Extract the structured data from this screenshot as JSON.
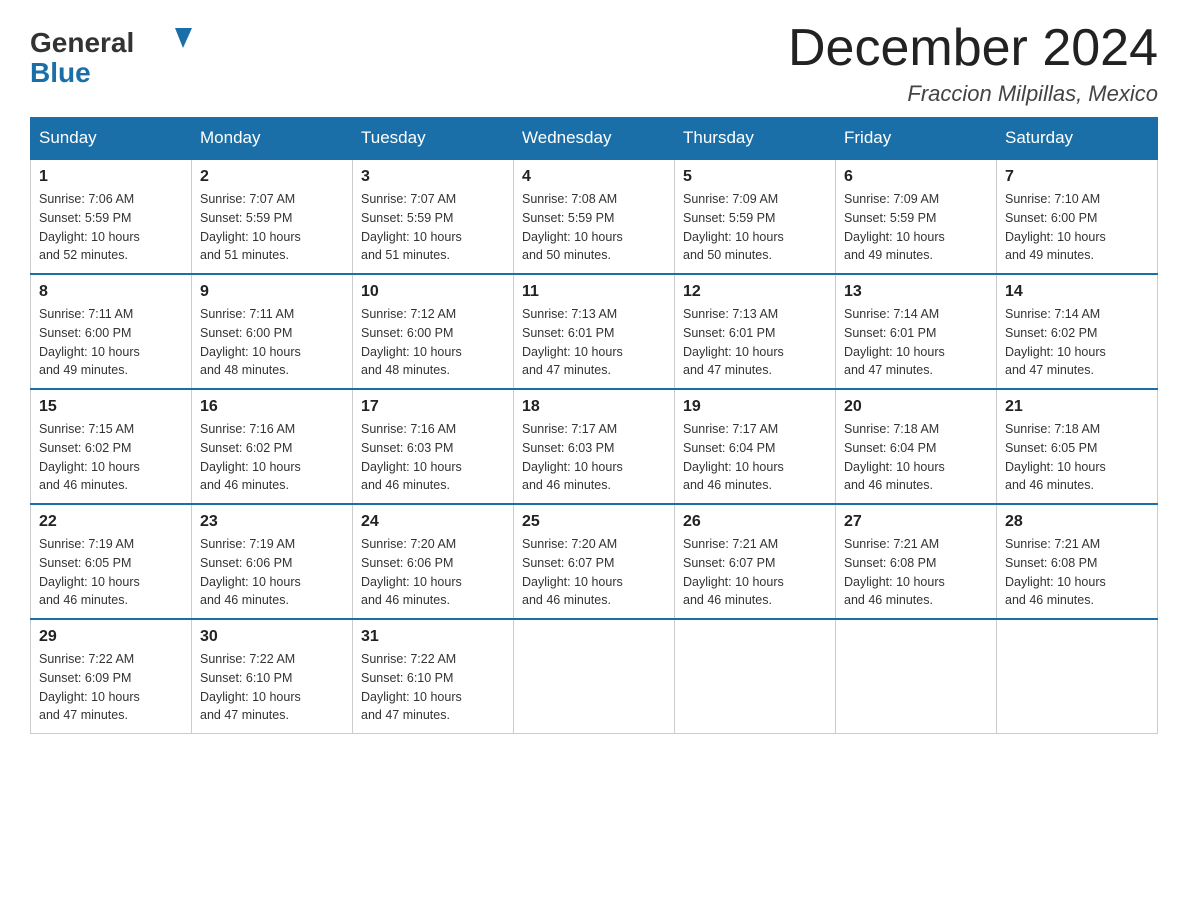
{
  "header": {
    "logo_general": "General",
    "logo_blue": "Blue",
    "month_title": "December 2024",
    "location": "Fraccion Milpillas, Mexico"
  },
  "weekdays": [
    "Sunday",
    "Monday",
    "Tuesday",
    "Wednesday",
    "Thursday",
    "Friday",
    "Saturday"
  ],
  "weeks": [
    [
      {
        "day": "1",
        "sunrise": "7:06 AM",
        "sunset": "5:59 PM",
        "daylight": "10 hours and 52 minutes."
      },
      {
        "day": "2",
        "sunrise": "7:07 AM",
        "sunset": "5:59 PM",
        "daylight": "10 hours and 51 minutes."
      },
      {
        "day": "3",
        "sunrise": "7:07 AM",
        "sunset": "5:59 PM",
        "daylight": "10 hours and 51 minutes."
      },
      {
        "day": "4",
        "sunrise": "7:08 AM",
        "sunset": "5:59 PM",
        "daylight": "10 hours and 50 minutes."
      },
      {
        "day": "5",
        "sunrise": "7:09 AM",
        "sunset": "5:59 PM",
        "daylight": "10 hours and 50 minutes."
      },
      {
        "day": "6",
        "sunrise": "7:09 AM",
        "sunset": "5:59 PM",
        "daylight": "10 hours and 49 minutes."
      },
      {
        "day": "7",
        "sunrise": "7:10 AM",
        "sunset": "6:00 PM",
        "daylight": "10 hours and 49 minutes."
      }
    ],
    [
      {
        "day": "8",
        "sunrise": "7:11 AM",
        "sunset": "6:00 PM",
        "daylight": "10 hours and 49 minutes."
      },
      {
        "day": "9",
        "sunrise": "7:11 AM",
        "sunset": "6:00 PM",
        "daylight": "10 hours and 48 minutes."
      },
      {
        "day": "10",
        "sunrise": "7:12 AM",
        "sunset": "6:00 PM",
        "daylight": "10 hours and 48 minutes."
      },
      {
        "day": "11",
        "sunrise": "7:13 AM",
        "sunset": "6:01 PM",
        "daylight": "10 hours and 47 minutes."
      },
      {
        "day": "12",
        "sunrise": "7:13 AM",
        "sunset": "6:01 PM",
        "daylight": "10 hours and 47 minutes."
      },
      {
        "day": "13",
        "sunrise": "7:14 AM",
        "sunset": "6:01 PM",
        "daylight": "10 hours and 47 minutes."
      },
      {
        "day": "14",
        "sunrise": "7:14 AM",
        "sunset": "6:02 PM",
        "daylight": "10 hours and 47 minutes."
      }
    ],
    [
      {
        "day": "15",
        "sunrise": "7:15 AM",
        "sunset": "6:02 PM",
        "daylight": "10 hours and 46 minutes."
      },
      {
        "day": "16",
        "sunrise": "7:16 AM",
        "sunset": "6:02 PM",
        "daylight": "10 hours and 46 minutes."
      },
      {
        "day": "17",
        "sunrise": "7:16 AM",
        "sunset": "6:03 PM",
        "daylight": "10 hours and 46 minutes."
      },
      {
        "day": "18",
        "sunrise": "7:17 AM",
        "sunset": "6:03 PM",
        "daylight": "10 hours and 46 minutes."
      },
      {
        "day": "19",
        "sunrise": "7:17 AM",
        "sunset": "6:04 PM",
        "daylight": "10 hours and 46 minutes."
      },
      {
        "day": "20",
        "sunrise": "7:18 AM",
        "sunset": "6:04 PM",
        "daylight": "10 hours and 46 minutes."
      },
      {
        "day": "21",
        "sunrise": "7:18 AM",
        "sunset": "6:05 PM",
        "daylight": "10 hours and 46 minutes."
      }
    ],
    [
      {
        "day": "22",
        "sunrise": "7:19 AM",
        "sunset": "6:05 PM",
        "daylight": "10 hours and 46 minutes."
      },
      {
        "day": "23",
        "sunrise": "7:19 AM",
        "sunset": "6:06 PM",
        "daylight": "10 hours and 46 minutes."
      },
      {
        "day": "24",
        "sunrise": "7:20 AM",
        "sunset": "6:06 PM",
        "daylight": "10 hours and 46 minutes."
      },
      {
        "day": "25",
        "sunrise": "7:20 AM",
        "sunset": "6:07 PM",
        "daylight": "10 hours and 46 minutes."
      },
      {
        "day": "26",
        "sunrise": "7:21 AM",
        "sunset": "6:07 PM",
        "daylight": "10 hours and 46 minutes."
      },
      {
        "day": "27",
        "sunrise": "7:21 AM",
        "sunset": "6:08 PM",
        "daylight": "10 hours and 46 minutes."
      },
      {
        "day": "28",
        "sunrise": "7:21 AM",
        "sunset": "6:08 PM",
        "daylight": "10 hours and 46 minutes."
      }
    ],
    [
      {
        "day": "29",
        "sunrise": "7:22 AM",
        "sunset": "6:09 PM",
        "daylight": "10 hours and 47 minutes."
      },
      {
        "day": "30",
        "sunrise": "7:22 AM",
        "sunset": "6:10 PM",
        "daylight": "10 hours and 47 minutes."
      },
      {
        "day": "31",
        "sunrise": "7:22 AM",
        "sunset": "6:10 PM",
        "daylight": "10 hours and 47 minutes."
      },
      null,
      null,
      null,
      null
    ]
  ],
  "labels": {
    "sunrise": "Sunrise:",
    "sunset": "Sunset:",
    "daylight": "Daylight:"
  }
}
